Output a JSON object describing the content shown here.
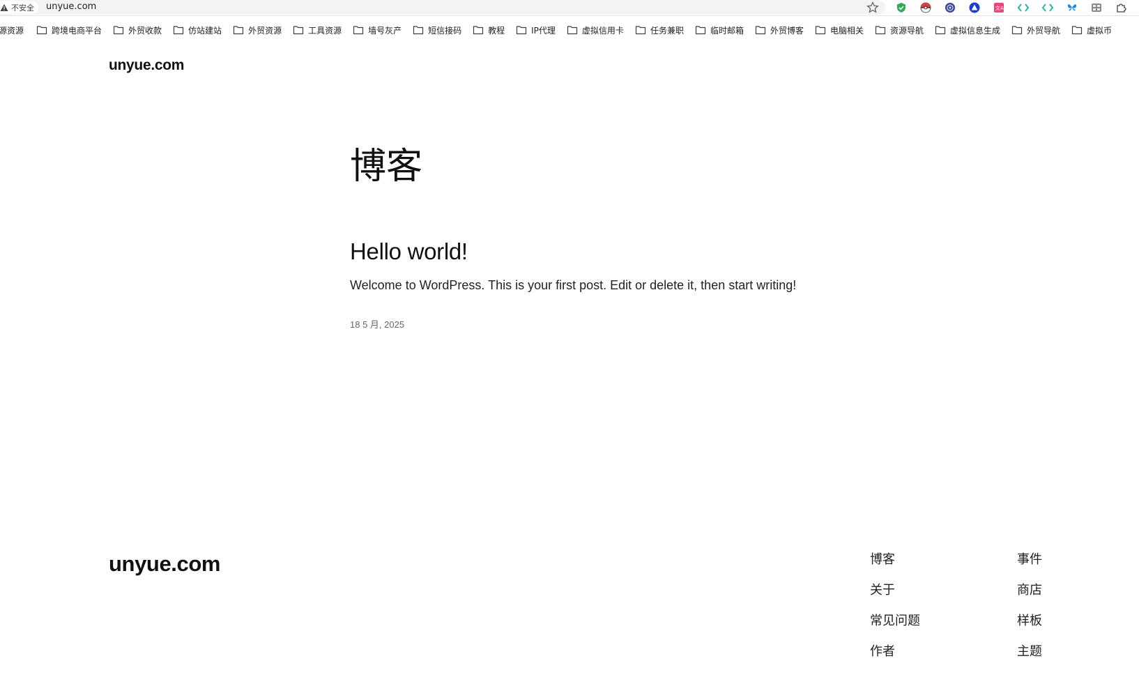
{
  "browser": {
    "security_label": "不安全",
    "url": "unyue.com",
    "extensions": [
      "shield-check-icon",
      "pokeball-icon",
      "globe-badge-icon",
      "triangle-logo-icon",
      "translate-icon",
      "diamond-arrows-icon",
      "diamond-arrows-icon-2",
      "butterfly-icon",
      "grid-app-icon",
      "puzzle-icon"
    ]
  },
  "bookmarks": [
    {
      "label": "源资源"
    },
    {
      "label": "跨境电商平台"
    },
    {
      "label": "外贸收款"
    },
    {
      "label": "仿站建站"
    },
    {
      "label": "外贸资源"
    },
    {
      "label": "工具资源"
    },
    {
      "label": "墙号灰产"
    },
    {
      "label": "短信接码"
    },
    {
      "label": "教程"
    },
    {
      "label": "IP代理"
    },
    {
      "label": "虚拟信用卡"
    },
    {
      "label": "任务兼职"
    },
    {
      "label": "临时邮箱"
    },
    {
      "label": "外贸博客"
    },
    {
      "label": "电脑相关"
    },
    {
      "label": "资源导航"
    },
    {
      "label": "虚拟信息生成"
    },
    {
      "label": "外贸导航"
    },
    {
      "label": "虚拟币"
    }
  ],
  "site": {
    "title": "unyue.com"
  },
  "main": {
    "heading": "博客",
    "post": {
      "title": "Hello world!",
      "excerpt": "Welcome to WordPress. This is your first post. Edit or delete it, then start writing!",
      "date": "18 5 月, 2025"
    }
  },
  "footer": {
    "title": "unyue.com",
    "col1": [
      "博客",
      "关于",
      "常见问题",
      "作者"
    ],
    "col2": [
      "事件",
      "商店",
      "样板",
      "主题"
    ]
  }
}
